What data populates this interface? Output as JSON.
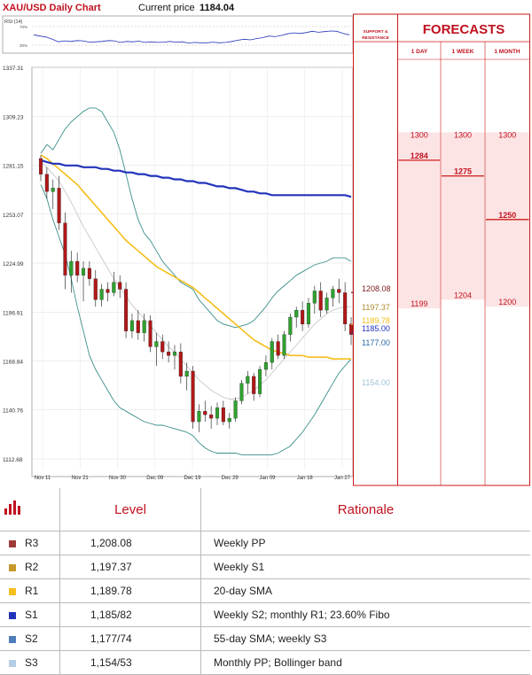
{
  "header": {
    "title": "XAU/USD Daily Chart",
    "current_price_label": "Current price",
    "current_price": "1184.04"
  },
  "rsi": {
    "label": "RSI (14)",
    "levels": [
      "70%",
      "30%"
    ]
  },
  "sr_panel": {
    "title_line1": "SUPPORT &",
    "title_line2": "RESISTANCE"
  },
  "forecasts": {
    "title": "FORECASTS",
    "columns": [
      "1 DAY",
      "1 WEEK",
      "1 MONTH"
    ],
    "ranges": [
      {
        "high": "1300",
        "target": "1284",
        "low": "1199"
      },
      {
        "high": "1300",
        "target": "1275",
        "low": "1204"
      },
      {
        "high": "1300",
        "target": "1250",
        "low": "1200"
      }
    ],
    "colors": {
      "band": "#fde4e4",
      "text": "#c0111f",
      "line": "#cc1a1a"
    }
  },
  "chart_data": {
    "type": "candlestick",
    "title": "XAU/USD Daily Chart",
    "y_ticks": [
      "1337.31",
      "1309.23",
      "1281.15",
      "1253.07",
      "1224.99",
      "1196.91",
      "1168.84",
      "1140.76",
      "1112.68"
    ],
    "ylim": [
      1112.68,
      1337.31
    ],
    "x_ticks": [
      "Nov 11",
      "Nov 21",
      "Nov 30",
      "Dec 09",
      "Dec 19",
      "Dec 29",
      "Jan 09",
      "Jan 18",
      "Jan 27"
    ],
    "grid": true,
    "candles": [
      {
        "o": 1285,
        "h": 1287,
        "l": 1272,
        "c": 1276
      },
      {
        "o": 1276,
        "h": 1280,
        "l": 1262,
        "c": 1266
      },
      {
        "o": 1266,
        "h": 1273,
        "l": 1256,
        "c": 1268
      },
      {
        "o": 1268,
        "h": 1275,
        "l": 1244,
        "c": 1248
      },
      {
        "o": 1248,
        "h": 1254,
        "l": 1210,
        "c": 1218
      },
      {
        "o": 1218,
        "h": 1232,
        "l": 1208,
        "c": 1226
      },
      {
        "o": 1226,
        "h": 1231,
        "l": 1214,
        "c": 1218
      },
      {
        "o": 1218,
        "h": 1226,
        "l": 1203,
        "c": 1222
      },
      {
        "o": 1222,
        "h": 1226,
        "l": 1212,
        "c": 1216
      },
      {
        "o": 1216,
        "h": 1221,
        "l": 1200,
        "c": 1204
      },
      {
        "o": 1204,
        "h": 1213,
        "l": 1200,
        "c": 1210
      },
      {
        "o": 1210,
        "h": 1214,
        "l": 1203,
        "c": 1208
      },
      {
        "o": 1208,
        "h": 1220,
        "l": 1206,
        "c": 1214
      },
      {
        "o": 1214,
        "h": 1218,
        "l": 1205,
        "c": 1210
      },
      {
        "o": 1210,
        "h": 1214,
        "l": 1182,
        "c": 1186
      },
      {
        "o": 1186,
        "h": 1196,
        "l": 1182,
        "c": 1192
      },
      {
        "o": 1192,
        "h": 1198,
        "l": 1181,
        "c": 1185
      },
      {
        "o": 1185,
        "h": 1196,
        "l": 1180,
        "c": 1192
      },
      {
        "o": 1192,
        "h": 1195,
        "l": 1174,
        "c": 1177
      },
      {
        "o": 1177,
        "h": 1185,
        "l": 1166,
        "c": 1180
      },
      {
        "o": 1180,
        "h": 1184,
        "l": 1170,
        "c": 1174
      },
      {
        "o": 1174,
        "h": 1180,
        "l": 1168,
        "c": 1172
      },
      {
        "o": 1172,
        "h": 1178,
        "l": 1164,
        "c": 1174
      },
      {
        "o": 1174,
        "h": 1179,
        "l": 1156,
        "c": 1160
      },
      {
        "o": 1160,
        "h": 1168,
        "l": 1152,
        "c": 1163
      },
      {
        "o": 1163,
        "h": 1166,
        "l": 1130,
        "c": 1134
      },
      {
        "o": 1134,
        "h": 1144,
        "l": 1128,
        "c": 1140
      },
      {
        "o": 1140,
        "h": 1146,
        "l": 1134,
        "c": 1138
      },
      {
        "o": 1138,
        "h": 1143,
        "l": 1130,
        "c": 1136
      },
      {
        "o": 1136,
        "h": 1145,
        "l": 1132,
        "c": 1142
      },
      {
        "o": 1142,
        "h": 1146,
        "l": 1132,
        "c": 1134
      },
      {
        "o": 1134,
        "h": 1139,
        "l": 1130,
        "c": 1136
      },
      {
        "o": 1136,
        "h": 1148,
        "l": 1134,
        "c": 1146
      },
      {
        "o": 1146,
        "h": 1158,
        "l": 1144,
        "c": 1156
      },
      {
        "o": 1156,
        "h": 1163,
        "l": 1150,
        "c": 1160
      },
      {
        "o": 1160,
        "h": 1162,
        "l": 1146,
        "c": 1150
      },
      {
        "o": 1150,
        "h": 1166,
        "l": 1148,
        "c": 1164
      },
      {
        "o": 1164,
        "h": 1172,
        "l": 1160,
        "c": 1168
      },
      {
        "o": 1168,
        "h": 1182,
        "l": 1164,
        "c": 1180
      },
      {
        "o": 1180,
        "h": 1184,
        "l": 1170,
        "c": 1172
      },
      {
        "o": 1172,
        "h": 1186,
        "l": 1170,
        "c": 1184
      },
      {
        "o": 1184,
        "h": 1196,
        "l": 1180,
        "c": 1194
      },
      {
        "o": 1194,
        "h": 1200,
        "l": 1188,
        "c": 1198
      },
      {
        "o": 1198,
        "h": 1203,
        "l": 1186,
        "c": 1190
      },
      {
        "o": 1190,
        "h": 1205,
        "l": 1188,
        "c": 1202
      },
      {
        "o": 1202,
        "h": 1212,
        "l": 1196,
        "c": 1209
      },
      {
        "o": 1209,
        "h": 1214,
        "l": 1194,
        "c": 1198
      },
      {
        "o": 1198,
        "h": 1208,
        "l": 1196,
        "c": 1205
      },
      {
        "o": 1205,
        "h": 1212,
        "l": 1200,
        "c": 1210
      },
      {
        "o": 1210,
        "h": 1216,
        "l": 1202,
        "c": 1208
      },
      {
        "o": 1208,
        "h": 1214,
        "l": 1186,
        "c": 1190
      },
      {
        "o": 1190,
        "h": 1194,
        "l": 1178,
        "c": 1184
      }
    ],
    "lines": [
      {
        "name": "bollinger_upper",
        "color": "#3a8f8a",
        "values": [
          1288,
          1293,
          1290,
          1296,
          1302,
          1306,
          1309,
          1312,
          1314,
          1314,
          1312,
          1306,
          1300,
          1290,
          1276,
          1262,
          1250,
          1242,
          1238,
          1232,
          1226,
          1222,
          1218,
          1214,
          1212,
          1210,
          1204,
          1200,
          1196,
          1192,
          1190,
          1189,
          1188,
          1189,
          1190,
          1192,
          1196,
          1200,
          1205,
          1209,
          1212,
          1215,
          1218,
          1220,
          1222,
          1224,
          1225,
          1226,
          1228,
          1228,
          1228,
          1226
        ]
      },
      {
        "name": "bollinger_mid",
        "color": "#c8c8c8",
        "values": [
          1283,
          1280,
          1276,
          1272,
          1266,
          1260,
          1253,
          1246,
          1240,
          1234,
          1228,
          1222,
          1216,
          1211,
          1206,
          1201,
          1197,
          1193,
          1189,
          1185,
          1181,
          1177,
          1174,
          1170,
          1166,
          1162,
          1158,
          1155,
          1152,
          1150,
          1148,
          1147,
          1147,
          1148,
          1150,
          1152,
          1155,
          1158,
          1162,
          1166,
          1170,
          1174,
          1178,
          1182,
          1186,
          1190,
          1193,
          1196,
          1198,
          1199,
          1200,
          1200
        ]
      },
      {
        "name": "bollinger_lower",
        "color": "#3a8f8a",
        "values": [
          1270,
          1262,
          1250,
          1240,
          1230,
          1216,
          1200,
          1186,
          1172,
          1164,
          1158,
          1152,
          1146,
          1142,
          1140,
          1138,
          1136,
          1134,
          1133,
          1132,
          1132,
          1131,
          1130,
          1129,
          1128,
          1126,
          1122,
          1119,
          1117,
          1116,
          1116,
          1116,
          1116,
          1115,
          1115,
          1115,
          1115,
          1115,
          1115,
          1116,
          1118,
          1120,
          1124,
          1128,
          1133,
          1138,
          1144,
          1150,
          1156,
          1162,
          1166,
          1170
        ]
      },
      {
        "name": "sma_20",
        "color": "#f6be1a",
        "values": [
          1287,
          1285,
          1282,
          1279,
          1276,
          1273,
          1270,
          1266,
          1262,
          1258,
          1254,
          1250,
          1246,
          1242,
          1238,
          1235,
          1232,
          1229,
          1226,
          1223,
          1221,
          1219,
          1217,
          1215,
          1213,
          1211,
          1208,
          1205,
          1202,
          1199,
          1196,
          1193,
          1190,
          1187,
          1184,
          1181,
          1179,
          1177,
          1175,
          1174,
          1173,
          1172,
          1172,
          1172,
          1171,
          1171,
          1171,
          1171,
          1170,
          1170,
          1170,
          1170
        ]
      },
      {
        "name": "sma_200",
        "color": "#2233bb",
        "values": [
          1284,
          1283,
          1282,
          1282,
          1281,
          1281,
          1281,
          1280,
          1280,
          1280,
          1279,
          1279,
          1278,
          1278,
          1277,
          1277,
          1276,
          1276,
          1275,
          1275,
          1274,
          1274,
          1273,
          1273,
          1272,
          1272,
          1271,
          1271,
          1270,
          1269,
          1269,
          1268,
          1268,
          1267,
          1266,
          1266,
          1265,
          1265,
          1264,
          1264,
          1264,
          1264,
          1264,
          1264,
          1264,
          1264,
          1264,
          1264,
          1264,
          1264,
          1264,
          1263
        ]
      }
    ],
    "rsi_values": [
      52,
      48,
      45,
      38,
      30,
      33,
      31,
      34,
      33,
      29,
      30,
      31,
      34,
      33,
      28,
      31,
      30,
      32,
      28,
      30,
      28,
      29,
      31,
      29,
      30,
      26,
      28,
      27,
      27,
      29,
      27,
      28,
      31,
      35,
      38,
      36,
      40,
      43,
      48,
      46,
      50,
      55,
      58,
      56,
      59,
      63,
      60,
      62,
      64,
      63,
      56,
      52
    ],
    "levels": [
      {
        "value": "1208.08",
        "color": "#7a1d1d",
        "line": true
      },
      {
        "value": "1197.37",
        "color": "#b08a2a",
        "line": false
      },
      {
        "value": "1189.78",
        "color": "#f6be1a",
        "line": true
      },
      {
        "value": "1185.00",
        "color": "#2233bb",
        "line": true
      },
      {
        "value": "1177.00",
        "color": "#2a6aa8",
        "line": false
      },
      {
        "value": "1154.00",
        "color": "#9fc5d8",
        "line": false
      }
    ]
  },
  "levels_table": {
    "headers": {
      "level": "Level",
      "rationale": "Rationale"
    },
    "rows": [
      {
        "code": "R3",
        "level": "1,208.08",
        "rationale": "Weekly PP",
        "color": "#a03a3a"
      },
      {
        "code": "R2",
        "level": "1,197.37",
        "rationale": "Weekly S1",
        "color": "#c69a2a"
      },
      {
        "code": "R1",
        "level": "1,189.78",
        "rationale": "20-day SMA",
        "color": "#f6be1a"
      },
      {
        "code": "S1",
        "level": "1,185/82",
        "rationale": "Weekly S2; monthly R1; 23.60% Fibo",
        "color": "#2233bb"
      },
      {
        "code": "S2",
        "level": "1,177/74",
        "rationale": "55-day SMA; weekly S3",
        "color": "#4f7dbb"
      },
      {
        "code": "S3",
        "level": "1,154/53",
        "rationale": "Monthly PP; Bollinger band",
        "color": "#b6cde6"
      }
    ]
  }
}
